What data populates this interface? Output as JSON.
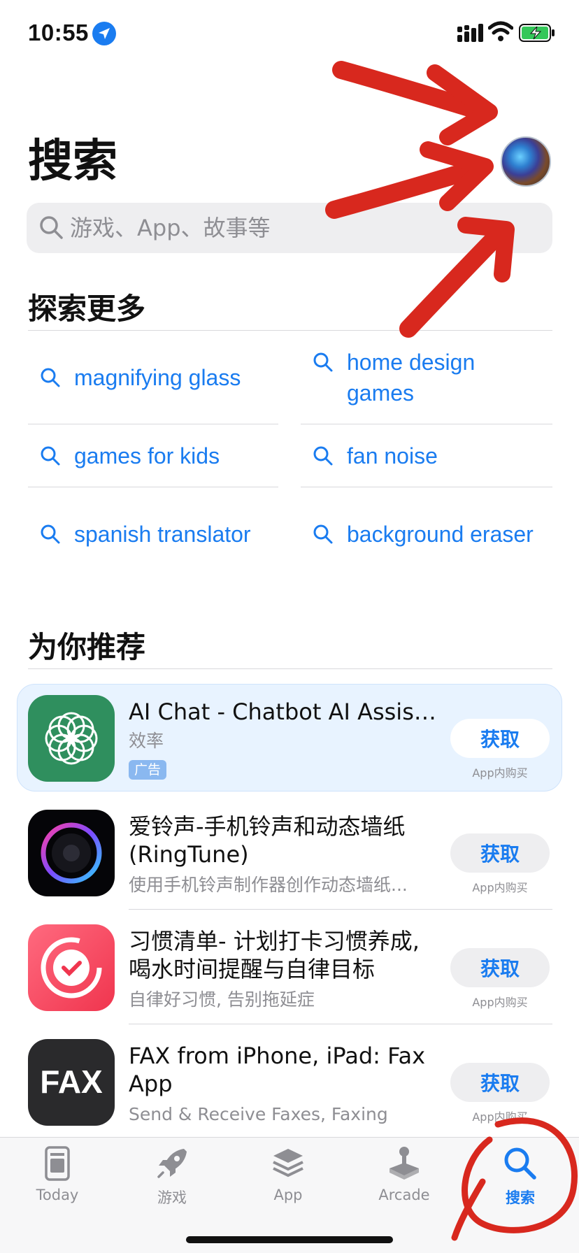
{
  "status_bar": {
    "time": "10:55"
  },
  "header": {
    "title": "搜索"
  },
  "search": {
    "placeholder": "游戏、App、故事等"
  },
  "discover": {
    "title": "探索更多",
    "left": [
      "magnifying glass",
      "games for kids",
      "spanish translator"
    ],
    "right": [
      "home design games",
      "fan noise",
      "background eraser"
    ]
  },
  "recommend": {
    "title": "为你推荐",
    "apps": [
      {
        "name": "AI Chat - Chatbot AI Assist...",
        "subtitle": "效率",
        "badge": "广告",
        "button": "获取",
        "iap": "App内购买"
      },
      {
        "name": "爱铃声-手机铃声和动态墙纸(RingTune)",
        "subtitle": "使用手机铃声制作器创作动态墙纸...",
        "button": "获取",
        "iap": "App内购买"
      },
      {
        "name": "习惯清单- 计划打卡习惯养成, 喝水时间提醒与自律目标",
        "subtitle": "自律好习惯, 告别拖延症",
        "button": "获取",
        "iap": "App内购买"
      },
      {
        "name": "FAX from iPhone, iPad: Fax App",
        "subtitle": "Send & Receive Faxes, Faxing",
        "button": "获取",
        "iap": "App内购买"
      }
    ],
    "icon_labels": {
      "fax": "FAX"
    }
  },
  "tabs": [
    {
      "label": "Today",
      "icon": "today-icon"
    },
    {
      "label": "游戏",
      "icon": "rocket-icon"
    },
    {
      "label": "App",
      "icon": "layers-icon"
    },
    {
      "label": "Arcade",
      "icon": "joystick-icon"
    },
    {
      "label": "搜索",
      "icon": "search-icon"
    }
  ],
  "colors": {
    "accent": "#1a7cf0",
    "annotation": "#d8281e"
  }
}
